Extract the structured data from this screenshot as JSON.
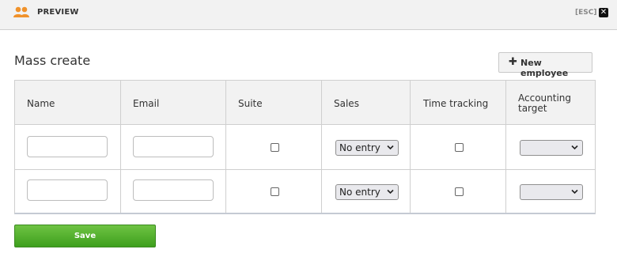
{
  "topbar": {
    "title": "PREVIEW",
    "esc_label": "[ESC]",
    "close_glyph": "✕",
    "icon": "users-icon",
    "icon_color": "#f0922b"
  },
  "page": {
    "heading": "Mass create"
  },
  "actions": {
    "new_employee_label": "New employee",
    "plus_glyph": "✚",
    "save_label": "Save",
    "save_color": "#52b12e"
  },
  "table": {
    "columns": [
      "Name",
      "Email",
      "Suite",
      "Sales",
      "Time tracking",
      "Accounting target"
    ],
    "rows": [
      {
        "name": "",
        "email": "",
        "suite": false,
        "sales": "No entry",
        "time_tracking": false,
        "accounting_target": ""
      },
      {
        "name": "",
        "email": "",
        "suite": false,
        "sales": "No entry",
        "time_tracking": false,
        "accounting_target": ""
      }
    ]
  }
}
